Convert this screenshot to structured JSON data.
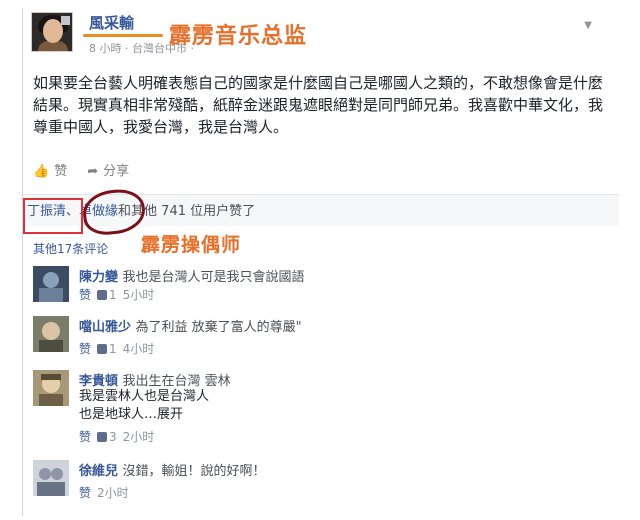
{
  "post": {
    "poster_name": "風采輸",
    "meta": "8 小時 · 台灣台中市 ·",
    "dropdown_icon": "chevron-down-icon",
    "text": "如果要全台藝人明確表態自己的國家是什麼國自己是哪國人之類的，不敢想像會是什麼結果。現實真相非常殘酷，紙醉金迷跟鬼遮眼絕對是同門師兄弟。我喜歡中華文化，我尊重中國人，我愛台灣，我是台灣人。"
  },
  "annotations": {
    "title": "霹雳音乐总监",
    "puppeteer": "霹雳操偶师",
    "accent_color": "#e8702a",
    "box_color": "#e0303a",
    "circle_color": "#7c1018"
  },
  "actions": {
    "like": "赞",
    "share": "分享",
    "like_icon": "thumbs-up-icon",
    "share_icon": "share-arrow-icon"
  },
  "likes": {
    "liker1": "丁振清",
    "sep": "、",
    "liker2": "卓做緣",
    "rest": "和其他 741 位用户赞了"
  },
  "other_comments": "其他17条评论",
  "comments": [
    {
      "name": "陳力變",
      "text": "我也是台灣人可是我只會說國語",
      "like_label": "赞",
      "likes": "1",
      "time": "5小时"
    },
    {
      "name": "噹山雅少",
      "text": "為了利益 放棄了富人的尊嚴\"",
      "like_label": "赞",
      "likes": "1",
      "time": "4小时"
    },
    {
      "name": "李貴頓",
      "text_line1": "我出生在台灣 雲林",
      "text_line2": "我是雲林人也是台灣人",
      "text_line3": "也是地球人…展开",
      "like_label": "赞",
      "likes": "3",
      "time": "2小时"
    },
    {
      "name": "徐維兒",
      "text": "沒錯，輸姐！說的好啊！",
      "like_label": "赞",
      "time": "2小时"
    }
  ]
}
